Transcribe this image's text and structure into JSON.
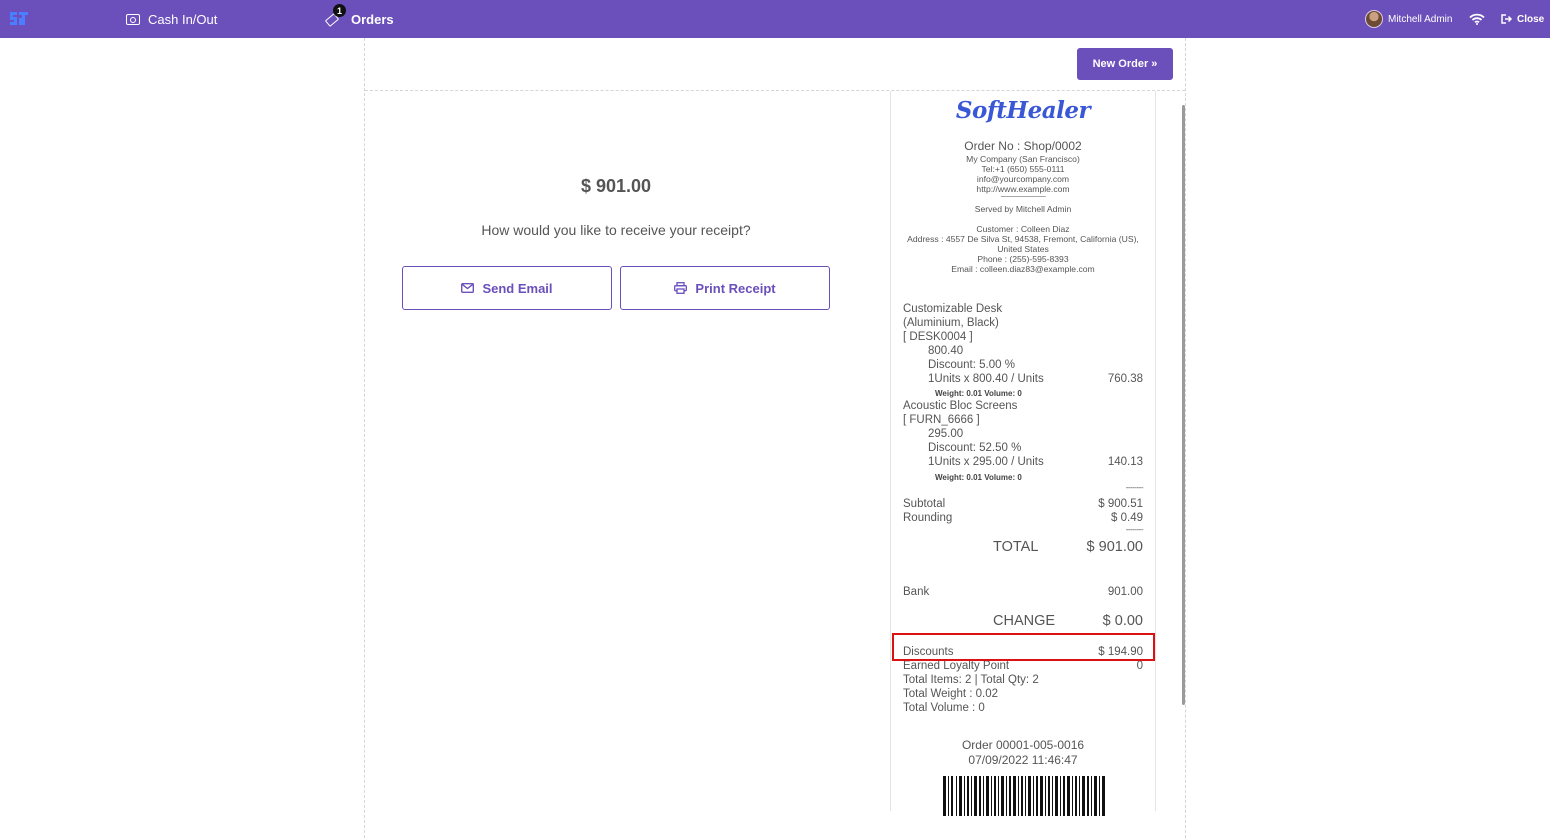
{
  "topbar": {
    "logo_icon": "softhealer-logo-icon",
    "cash_label": "Cash In/Out",
    "orders_label": "Orders",
    "orders_badge": "1",
    "user_name": "Mitchell Admin",
    "close_label": "Close",
    "bg_color": "#6b4fbb"
  },
  "main": {
    "new_order_label": "New Order »",
    "amount": "$ 901.00",
    "question": "How would you like to receive your receipt?",
    "send_email_label": "Send Email",
    "print_receipt_label": "Print Receipt"
  },
  "receipt": {
    "brand": "SoftHealer",
    "order_no": "Order No : Shop/0002",
    "company": "My Company (San Francisco)",
    "tel": "Tel:+1 (650) 555-0111",
    "email": "info@yourcompany.com",
    "website": "http://www.example.com",
    "separator": "--------------------------------",
    "served_by": "Served by Mitchell Admin",
    "customer": "Customer : Colleen Diaz",
    "address_1": "Address : 4557 De Silva St, 94538, Fremont, California (US),",
    "address_2": "United States",
    "phone": "Phone : (255)-595-8393",
    "customer_email": "Email : colleen.diaz83@example.com",
    "lines": [
      {
        "name_1": "Customizable Desk",
        "name_2": "(Aluminium, Black)",
        "code": "[ DESK0004 ]",
        "price": "800.40",
        "discount": "Discount: 5.00 %",
        "qty": "1Units x 800.40 / Units",
        "total": "760.38",
        "weight": "Weight: 0.01 Volume: 0"
      },
      {
        "name_1": "Acoustic Bloc Screens",
        "code": "[ FURN_6666 ]",
        "price": "295.00",
        "discount": "Discount: 52.50 %",
        "qty": "1Units x 295.00 / Units",
        "total": "140.13",
        "weight": "Weight: 0.01 Volume: 0"
      }
    ],
    "dashes": "--------",
    "subtotal_label": "Subtotal",
    "subtotal": "$ 900.51",
    "rounding_label": "Rounding",
    "rounding": "$ 0.49",
    "total_label": "TOTAL",
    "total": "$ 901.00",
    "bank_label": "Bank",
    "bank": "901.00",
    "change_label": "CHANGE",
    "change": "$ 0.00",
    "discounts_label": "Discounts",
    "discounts": "$ 194.90",
    "loyalty_label": "Earned Loyalty Point",
    "loyalty": "0",
    "total_items": "Total Items: 2 | Total Qty: 2",
    "total_weight": "Total Weight : 0.02",
    "total_volume": "Total Volume : 0",
    "order_ref": "Order 00001-005-0016",
    "order_date": "07/09/2022 11:46:47"
  }
}
